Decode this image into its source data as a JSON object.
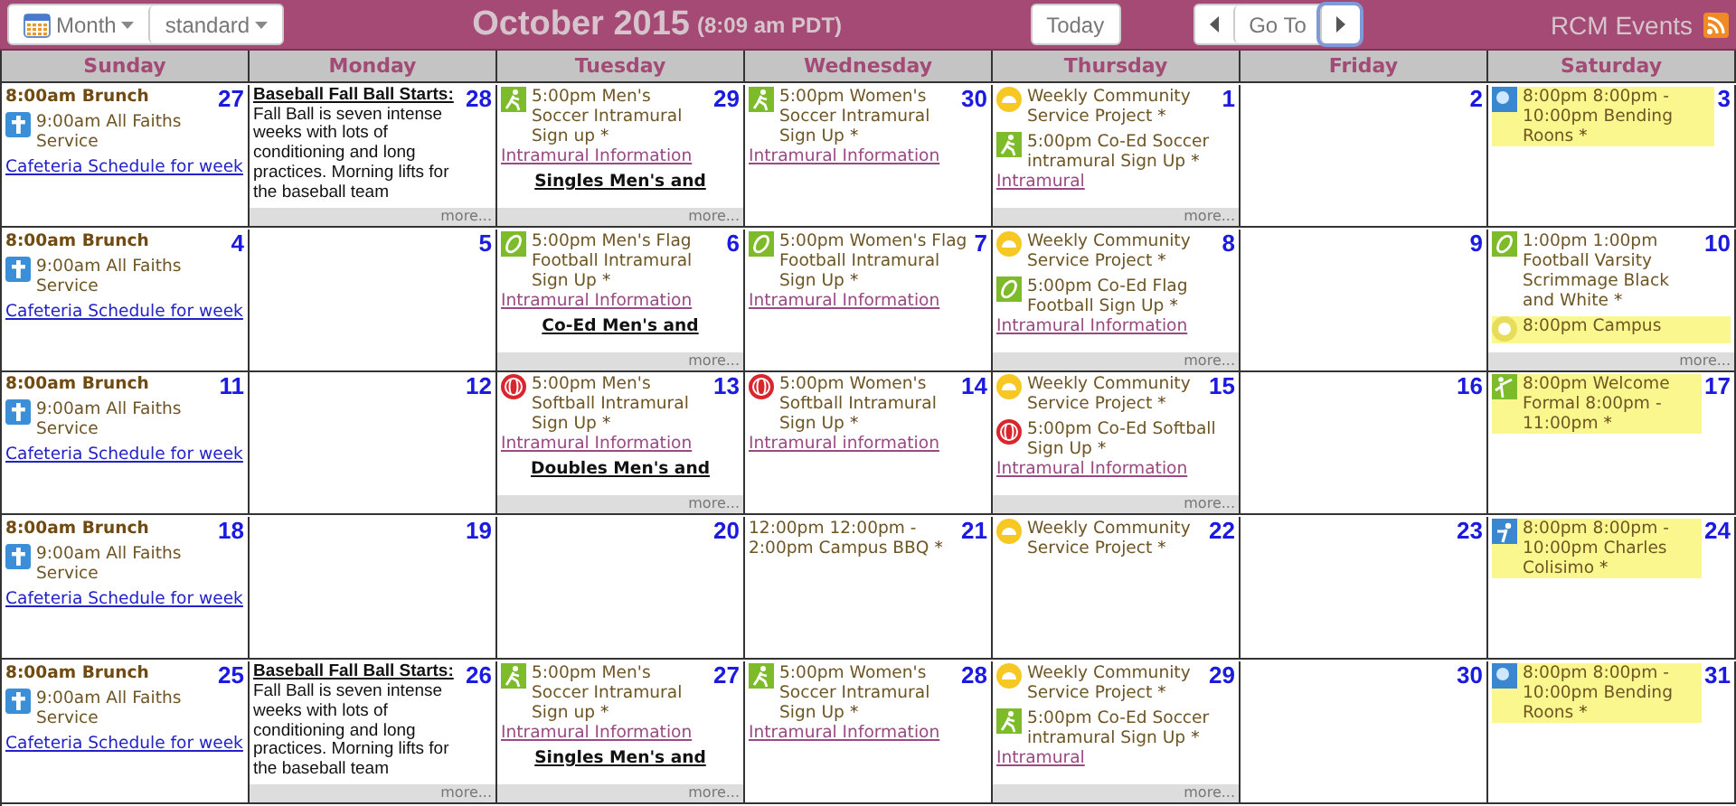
{
  "toolbar": {
    "view_menu": "Month",
    "style_menu": "standard",
    "title": "October 2015",
    "time": "(8:09 am PDT)",
    "today_button": "Today",
    "goto_button": "Go To",
    "calendar_name": "RCM Events"
  },
  "weekdays": [
    "Sunday",
    "Monday",
    "Tuesday",
    "Wednesday",
    "Thursday",
    "Friday",
    "Saturday"
  ],
  "weeks": [
    {
      "days": [
        {
          "date": "27",
          "items": [
            {
              "kind": "title",
              "text": "8:00am Brunch"
            },
            {
              "kind": "cross",
              "text": "9:00am All Faiths Service"
            },
            {
              "kind": "link",
              "text": "Cafeteria Schedule for week"
            }
          ]
        },
        {
          "date": "28",
          "more": "more...",
          "items": [
            {
              "kind": "article",
              "heading": "Baseball Fall Ball Starts:",
              "text": "Fall Ball is seven intense weeks with lots of conditioning and long practices. Morning lifts for the baseball team"
            }
          ]
        },
        {
          "date": "29",
          "more": "more...",
          "items": [
            {
              "kind": "runner",
              "text": "5:00pm Men's Soccer Intramural Sign up",
              "mark": "*",
              "link": "Intramural Information"
            },
            {
              "kind": "heading",
              "text": "Singles Men's and"
            }
          ]
        },
        {
          "date": "30",
          "items": [
            {
              "kind": "runner",
              "text": "5:00pm Women's Soccer Intramural Sign Up",
              "mark": "*",
              "link": "Intramural Information"
            }
          ]
        },
        {
          "date": "1",
          "more": "more...",
          "items": [
            {
              "kind": "sun",
              "text": "Weekly Community Service Project",
              "mark": "*"
            },
            {
              "kind": "runner",
              "text": "5:00pm Co-Ed Soccer intramural Sign Up",
              "mark": "*",
              "link": "Intramural"
            }
          ]
        },
        {
          "date": "2"
        },
        {
          "date": "3",
          "items": [
            {
              "kind": "sky",
              "highlight": true,
              "text": "8:00pm 8:00pm - 10:00pm Bending Roons",
              "mark": "*"
            }
          ]
        }
      ]
    },
    {
      "days": [
        {
          "date": "4",
          "items": [
            {
              "kind": "title",
              "text": "8:00am Brunch"
            },
            {
              "kind": "cross",
              "text": "9:00am All Faiths Service"
            },
            {
              "kind": "link",
              "text": "Cafeteria Schedule for week"
            }
          ]
        },
        {
          "date": "5"
        },
        {
          "date": "6",
          "more": "more...",
          "items": [
            {
              "kind": "football",
              "text": "5:00pm Men's Flag Football Intramural Sign Up",
              "mark": "*",
              "link": "Intramural Information"
            },
            {
              "kind": "heading",
              "text": "Co-Ed Men's and"
            }
          ]
        },
        {
          "date": "7",
          "items": [
            {
              "kind": "football",
              "text": "5:00pm Women's Flag Football Intramural Sign Up",
              "mark": "*",
              "link": "Intramural Information"
            }
          ]
        },
        {
          "date": "8",
          "more": "more...",
          "items": [
            {
              "kind": "sun",
              "text": "Weekly Community Service Project",
              "mark": "*"
            },
            {
              "kind": "football",
              "text": "5:00pm Co-Ed Flag Football Sign Up",
              "mark": "*",
              "link": "Intramural Information"
            }
          ]
        },
        {
          "date": "9"
        },
        {
          "date": "10",
          "more": "more...",
          "items": [
            {
              "kind": "football",
              "text": "1:00pm 1:00pm Football Varsity Scrimmage Black and White",
              "mark": "*"
            },
            {
              "kind": "campus",
              "highlight": true,
              "text": "8:00pm Campus"
            }
          ]
        }
      ]
    },
    {
      "days": [
        {
          "date": "11",
          "items": [
            {
              "kind": "title",
              "text": "8:00am Brunch"
            },
            {
              "kind": "cross",
              "text": "9:00am All Faiths Service"
            },
            {
              "kind": "link",
              "text": "Cafeteria Schedule for week"
            }
          ]
        },
        {
          "date": "12"
        },
        {
          "date": "13",
          "more": "more...",
          "items": [
            {
              "kind": "softball",
              "text": "5:00pm Men's Softball Intramural Sign Up",
              "mark": "*",
              "link": "Intramural Information"
            },
            {
              "kind": "heading",
              "text": "Doubles Men's and"
            }
          ]
        },
        {
          "date": "14",
          "items": [
            {
              "kind": "softball",
              "text": "5:00pm Women's Softball Intramural Sign Up",
              "mark": "*",
              "link": "Intramural information"
            }
          ]
        },
        {
          "date": "15",
          "more": "more...",
          "items": [
            {
              "kind": "sun",
              "text": "Weekly Community Service Project",
              "mark": "*"
            },
            {
              "kind": "softball",
              "text": "5:00pm Co-Ed Softball Sign Up",
              "mark": "*",
              "link": "Intramural Information"
            }
          ]
        },
        {
          "date": "16"
        },
        {
          "date": "17",
          "items": [
            {
              "kind": "dance",
              "highlight": true,
              "text": "8:00pm Welcome Formal 8:00pm - 11:00pm",
              "mark": "*"
            }
          ]
        }
      ]
    },
    {
      "days": [
        {
          "date": "18",
          "items": [
            {
              "kind": "title",
              "text": "8:00am Brunch"
            },
            {
              "kind": "cross",
              "text": "9:00am All Faiths Service"
            },
            {
              "kind": "link",
              "text": "Cafeteria Schedule for week"
            }
          ]
        },
        {
          "date": "19"
        },
        {
          "date": "20"
        },
        {
          "date": "21",
          "items": [
            {
              "kind": "plain",
              "text": "12:00pm 12:00pm - 2:00pm Campus BBQ",
              "mark": "*"
            }
          ]
        },
        {
          "date": "22",
          "items": [
            {
              "kind": "sun",
              "text": "Weekly Community Service Project",
              "mark": "*"
            }
          ]
        },
        {
          "date": "23"
        },
        {
          "date": "24",
          "items": [
            {
              "kind": "person",
              "highlight": true,
              "text": "8:00pm 8:00pm - 10:00pm Charles Colisimo",
              "mark": "*"
            }
          ]
        }
      ]
    },
    {
      "days": [
        {
          "date": "25",
          "items": [
            {
              "kind": "title",
              "text": "8:00am Brunch"
            },
            {
              "kind": "cross",
              "text": "9:00am All Faiths Service"
            },
            {
              "kind": "link",
              "text": "Cafeteria Schedule for week"
            }
          ]
        },
        {
          "date": "26",
          "more": "more...",
          "items": [
            {
              "kind": "article",
              "heading": "Baseball Fall Ball Starts:",
              "text": "Fall Ball is seven intense weeks with lots of conditioning and long practices. Morning lifts for the baseball team"
            }
          ]
        },
        {
          "date": "27",
          "more": "more...",
          "items": [
            {
              "kind": "runner",
              "text": "5:00pm Men's Soccer Intramural Sign up",
              "mark": "*",
              "link": "Intramural Information"
            },
            {
              "kind": "heading",
              "text": "Singles Men's and"
            }
          ]
        },
        {
          "date": "28",
          "items": [
            {
              "kind": "runner",
              "text": "5:00pm Women's Soccer Intramural Sign Up",
              "mark": "*",
              "link": "Intramural Information"
            }
          ]
        },
        {
          "date": "29",
          "more": "more...",
          "items": [
            {
              "kind": "sun",
              "text": "Weekly Community Service Project",
              "mark": "*"
            },
            {
              "kind": "runner",
              "text": "5:00pm Co-Ed Soccer intramural Sign Up",
              "mark": "*",
              "link": "Intramural"
            }
          ]
        },
        {
          "date": "30"
        },
        {
          "date": "31",
          "items": [
            {
              "kind": "sky",
              "highlight": true,
              "text": "8:00pm 8:00pm - 10:00pm Bending Roons",
              "mark": "*"
            }
          ]
        }
      ]
    }
  ]
}
